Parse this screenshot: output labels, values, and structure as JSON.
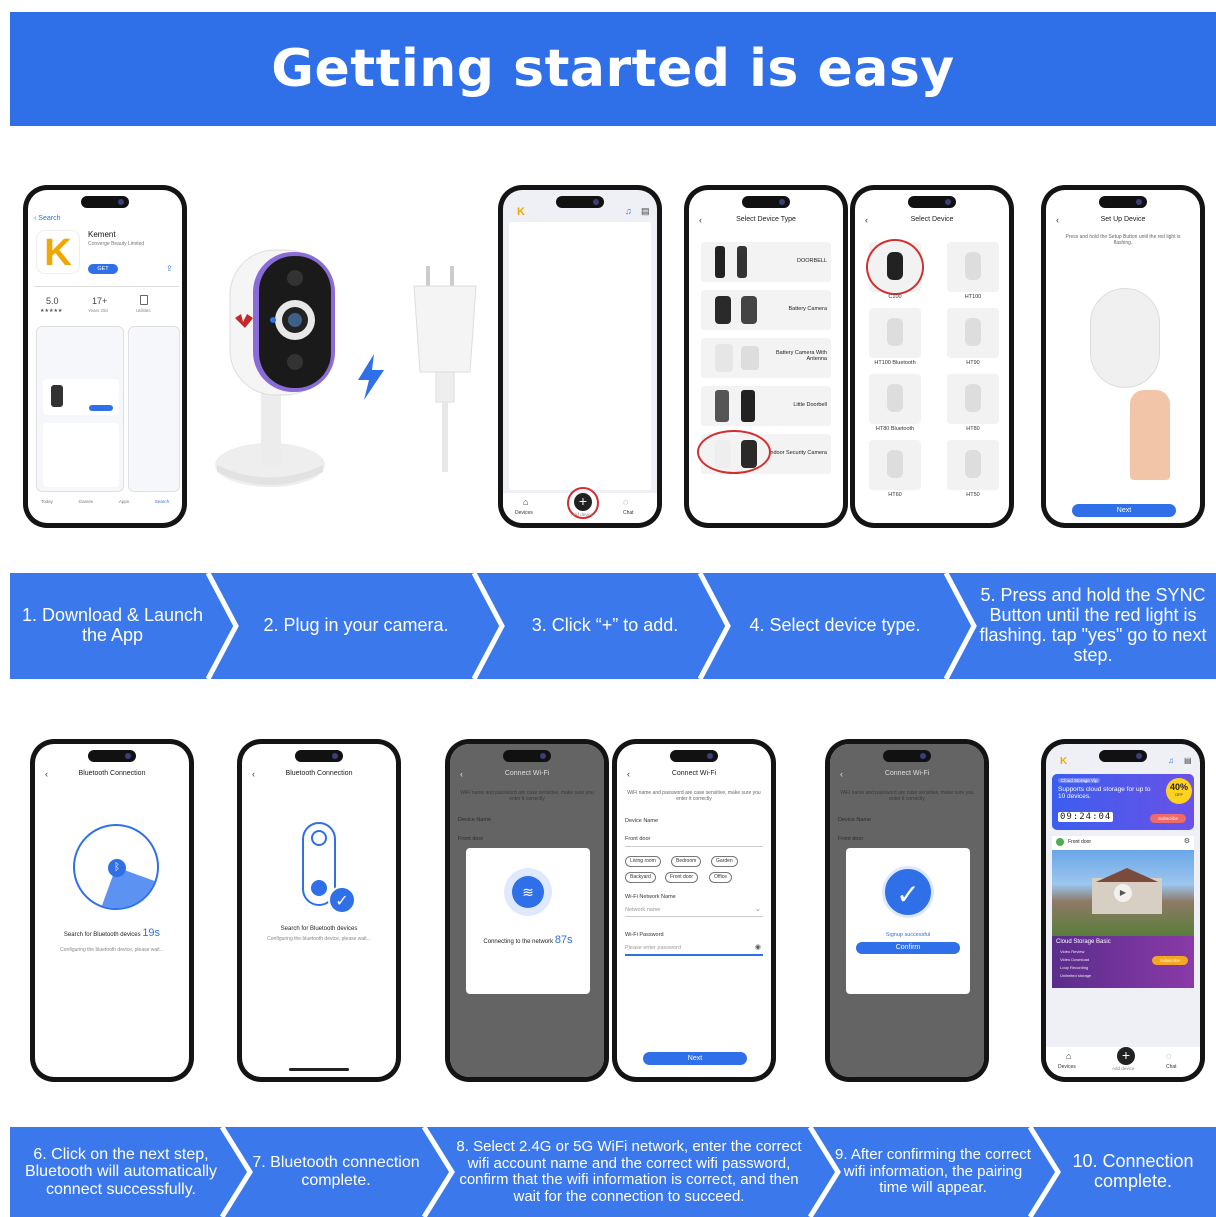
{
  "banner": {
    "title": "Getting started is easy"
  },
  "steps_top": [
    "1. Download & Launch the App",
    "2. Plug in your camera.",
    "3. Click “+” to add.",
    "4. Select device type.",
    "5. Press and hold the SYNC Button until the red light is flashing. tap \"yes\" go to next step."
  ],
  "steps_bottom": [
    "6. Click on the next step, Bluetooth will automatically connect successfully.",
    "7. Bluetooth connection complete.",
    "8. Select 2.4G or 5G WiFi network, enter the correct wifi account name and the correct wifi password, confirm that the wifi information is correct, and then wait for the connection to succeed.",
    "9. After confirming the correct wifi information, the pairing time will appear.",
    "10. Connection complete."
  ],
  "appstore": {
    "back": "Search",
    "app_name": "Kement",
    "developer": "Converge Beauty Limited",
    "get": "GET",
    "rating": "5.0",
    "stars": "★★★★★",
    "age": "17+",
    "age_sub": "Years Old",
    "cat": "Utilities",
    "tabs": [
      "Today",
      "Games",
      "Apps",
      "Search"
    ]
  },
  "home": {
    "logo": "K",
    "nav": [
      "Devices",
      "Add device",
      "Chat"
    ]
  },
  "device_type": {
    "title": "Select Device Type",
    "items": [
      "DOORBELL",
      "Battery Camera",
      "Battery Camera With Antenna",
      "Little Doorbell",
      "Indoor Security Camera"
    ]
  },
  "select_device": {
    "title": "Select Device",
    "items": [
      "C100",
      "HT100",
      "HT100 Bluetooth",
      "HT90",
      "HT80 Bluetooth",
      "HT80",
      "HT60",
      "HT50"
    ]
  },
  "setup": {
    "title": "Set Up Device",
    "hint": "Press and hold the Setup Button until the red light is flashing.",
    "next": "Next"
  },
  "bt1": {
    "title": "Bluetooth Connection",
    "search": "Search for Bluetooth devices",
    "count": "19s",
    "sub": "Configuring the bluetooth device, please wait..."
  },
  "bt2": {
    "title": "Bluetooth Connection",
    "search": "Search for Bluetooth devices",
    "sub": "Configuring the bluetooth device, please wait..."
  },
  "wifi": {
    "title": "Connect Wi-Fi",
    "hint": "WiFi name and password are case sensitive, make sure you enter it correctly",
    "device_name": "Device Name",
    "front_door": "Front door",
    "chips": [
      "Living room",
      "Bedroom",
      "Garden",
      "Backyard",
      "Front door",
      "Office"
    ],
    "network_label": "Wi-Fi Network Name",
    "network_ph": "Network name",
    "pwd_label": "Wi-Fi Password",
    "pwd_ph": "Please enter password",
    "next": "Next",
    "connecting": "Connecting to the network",
    "count": "87s",
    "success": "Signup successful",
    "confirm": "Confirm"
  },
  "final": {
    "logo": "K",
    "promo_tag": "Cloud Storage Vip",
    "promo": "Supports cloud storage for up to 10 devices.",
    "discount": "40%",
    "off": "OFF",
    "timer": "09:24:04",
    "subscribe": "Subscribe",
    "cam": "Front door",
    "basic": "Cloud Storage Basic",
    "features": [
      "Video Review",
      "Video Download",
      "Loop Recording",
      "Unlimited storage"
    ],
    "nav": [
      "Devices",
      "Add device",
      "Chat"
    ]
  },
  "colors": {
    "brand_blue": "#2f6fe8",
    "strip_blue": "#3a78ec",
    "accent_purple": "#8a6cd8"
  }
}
